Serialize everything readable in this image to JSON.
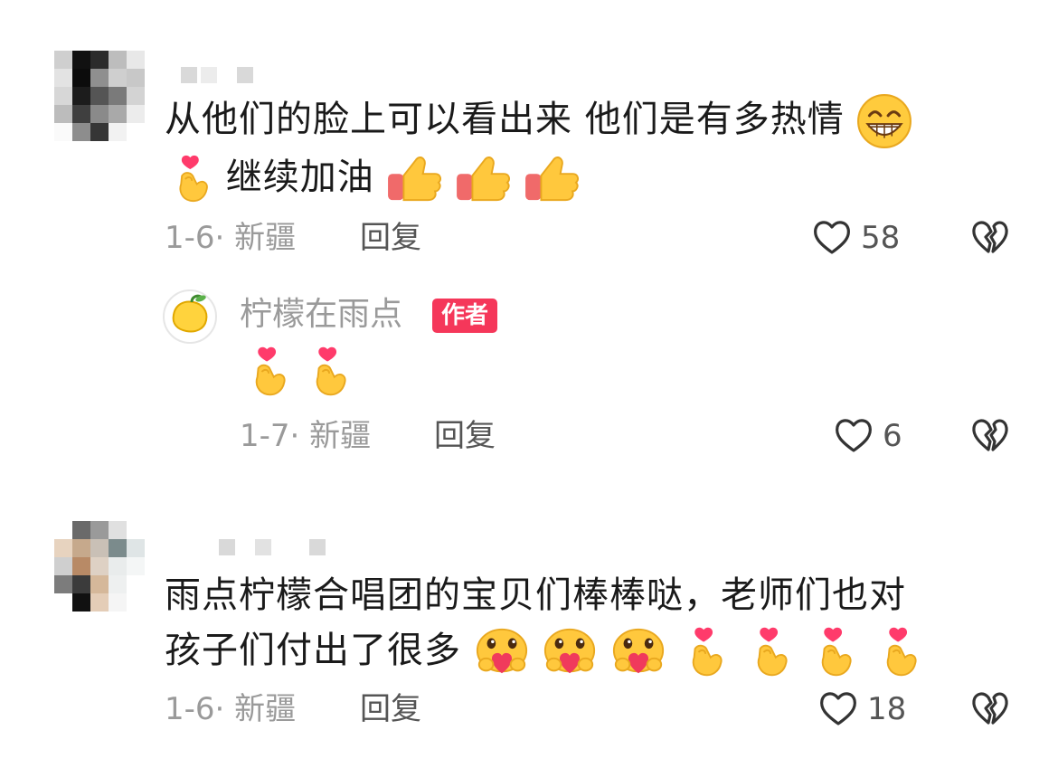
{
  "comments": [
    {
      "text_line1": "从他们的脸上可以看出来  他们是有多热情",
      "text_line2": "继续加油",
      "date": "1-6· 新疆",
      "reply_label": "回复",
      "likes": "58",
      "emojis_line1": [
        "grin-emoji"
      ],
      "emojis_line2_lead": [
        "finger-heart-emoji"
      ],
      "emojis_line2_trail": [
        "thumbs-up-emoji",
        "thumbs-up-emoji",
        "thumbs-up-emoji"
      ]
    },
    {
      "text_line1": "雨点柠檬合唱团的宝贝们棒棒哒，老师们也对",
      "text_line2": "孩子们付出了很多",
      "date": "1-6· 新疆",
      "reply_label": "回复",
      "likes": "18",
      "emojis_line2_trail": [
        "heart-hug-emoji",
        "heart-hug-emoji",
        "heart-hug-emoji",
        "finger-heart-emoji",
        "finger-heart-emoji",
        "finger-heart-emoji",
        "finger-heart-emoji"
      ]
    }
  ],
  "reply": {
    "author_name": "柠檬在雨点",
    "author_badge": "作者",
    "emojis": [
      "finger-heart-emoji",
      "finger-heart-emoji"
    ],
    "date": "1-7· 新疆",
    "reply_label": "回复",
    "likes": "6"
  },
  "colors": {
    "badge": "#f5375a",
    "meta_text": "#9a9a9a",
    "body_text": "#1a1a1a"
  },
  "icons": {
    "like": "heart-outline-icon",
    "dislike": "broken-heart-outline-icon"
  }
}
